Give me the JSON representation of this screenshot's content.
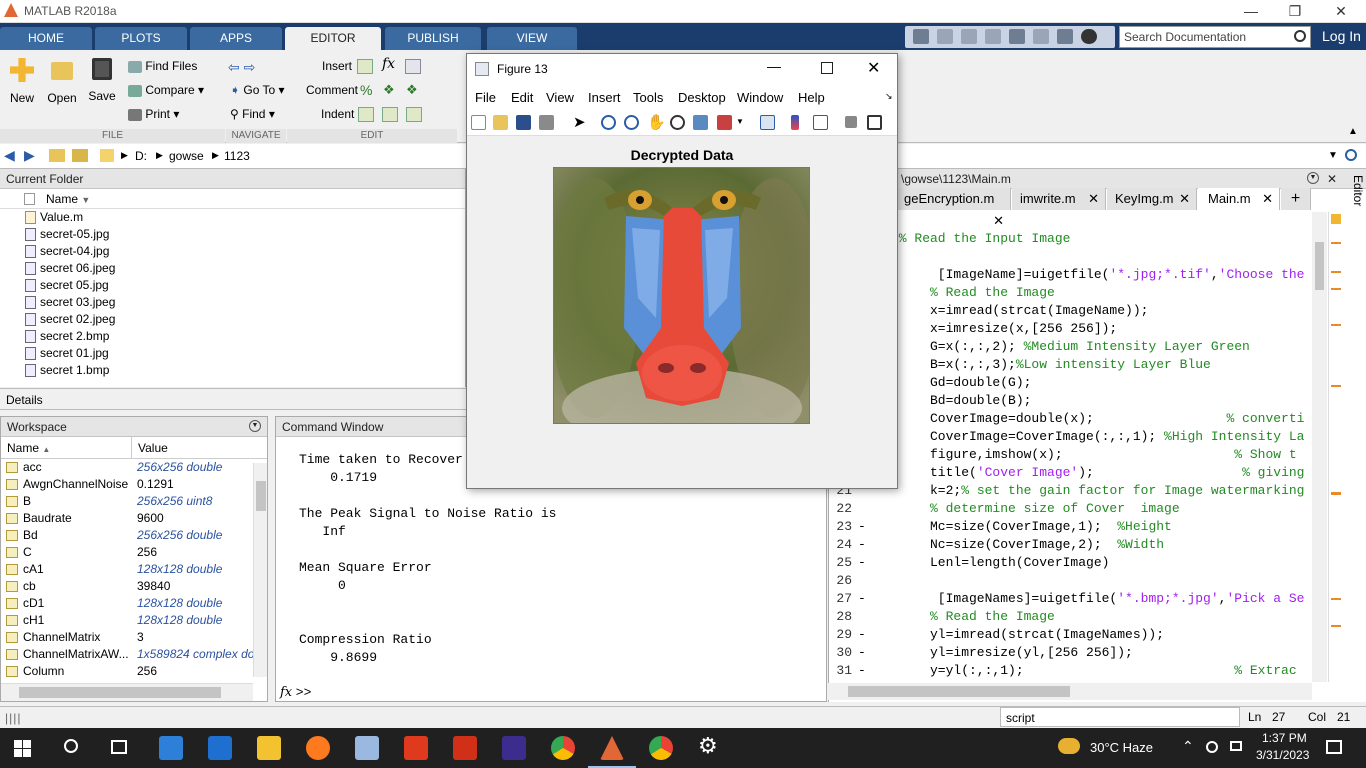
{
  "window": {
    "title": "MATLAB R2018a"
  },
  "ribbon_tabs": [
    "HOME",
    "PLOTS",
    "APPS",
    "EDITOR",
    "PUBLISH",
    "VIEW"
  ],
  "search": {
    "placeholder": "Search Documentation"
  },
  "login": "Log In",
  "ribbon": {
    "new": "New",
    "open": "Open",
    "save": "Save",
    "find_files": "Find Files",
    "compare": "Compare",
    "print": "Print",
    "go_to": "Go To",
    "find": "Find",
    "insert": "Insert",
    "comment": "Comment",
    "indent": "Indent",
    "groups": {
      "file": "FILE",
      "navigate": "NAVIGATE",
      "edit": "EDIT"
    }
  },
  "address": {
    "drive": "D:",
    "folder1": "gowse",
    "folder2": "1123"
  },
  "current_folder": {
    "title": "Current Folder",
    "column": "Name",
    "files": [
      "Value.m",
      "secret-05.jpg",
      "secret-04.jpg",
      "secret 06.jpeg",
      "secret 05.jpg",
      "secret 03.jpeg",
      "secret 02.jpeg",
      "secret 2.bmp",
      "secret 01.jpg",
      "secret 1.bmp"
    ]
  },
  "details": {
    "title": "Details"
  },
  "workspace": {
    "title": "Workspace",
    "col_name": "Name",
    "col_value": "Value",
    "rows": [
      {
        "name": "acc",
        "value": "256x256 double",
        "italic": true
      },
      {
        "name": "AwgnChannelNoise",
        "value": "0.1291",
        "italic": false
      },
      {
        "name": "B",
        "value": "256x256 uint8",
        "italic": true
      },
      {
        "name": "Baudrate",
        "value": "9600",
        "italic": false
      },
      {
        "name": "Bd",
        "value": "256x256 double",
        "italic": true
      },
      {
        "name": "C",
        "value": "256",
        "italic": false
      },
      {
        "name": "cA1",
        "value": "128x128 double",
        "italic": true
      },
      {
        "name": "cb",
        "value": "39840",
        "italic": false
      },
      {
        "name": "cD1",
        "value": "128x128 double",
        "italic": true
      },
      {
        "name": "cH1",
        "value": "128x128 double",
        "italic": true
      },
      {
        "name": "ChannelMatrix",
        "value": "3",
        "italic": false
      },
      {
        "name": "ChannelMatrixAW...",
        "value": "1x589824 complex do...",
        "italic": true
      },
      {
        "name": "Column",
        "value": "256",
        "italic": false
      }
    ]
  },
  "command_window": {
    "title": "Command Window",
    "lines": [
      "Time taken to Recover",
      "    0.1719",
      "",
      "The Peak Signal to Noise Ratio is",
      "   Inf",
      "",
      "Mean Square Error",
      "     0",
      "",
      "",
      "Compression Ratio",
      "    9.8699"
    ],
    "prompt": ">>"
  },
  "editor": {
    "path": "\\gowse\\1123\\Main.m",
    "side_label": "Editor",
    "tabs": [
      "geEncryption.m",
      "imwrite.m",
      "KeyImg.m",
      "Main.m"
    ],
    "lines": [
      {
        "n": "",
        "dash": "",
        "parts": [
          {
            "t": "% Read the Input Image",
            "c": "cmt"
          }
        ],
        "indent": -4
      },
      {
        "n": "",
        "dash": "",
        "parts": [],
        "indent": 0
      },
      {
        "n": "",
        "dash": "",
        "parts": [
          {
            "t": "[ImageName]=uigetfile(",
            "c": ""
          },
          {
            "t": "'*.jpg;*.tif'",
            "c": "str"
          },
          {
            "t": ",",
            "c": ""
          },
          {
            "t": "'Choose the",
            "c": "str"
          }
        ],
        "indent": 1
      },
      {
        "n": "",
        "dash": "",
        "parts": [
          {
            "t": "% Read the Image",
            "c": "cmt"
          }
        ],
        "indent": 0
      },
      {
        "n": "",
        "dash": "",
        "parts": [
          {
            "t": "x=imread(strcat(ImageName));",
            "c": ""
          }
        ],
        "indent": 0
      },
      {
        "n": "",
        "dash": "",
        "parts": [
          {
            "t": "x=imresize(x,[256 256]);",
            "c": ""
          }
        ],
        "indent": 0
      },
      {
        "n": "",
        "dash": "",
        "parts": [
          {
            "t": "G=x(:,:,2); ",
            "c": ""
          },
          {
            "t": "%Medium Intensity Layer Green",
            "c": "cmt"
          }
        ],
        "indent": 0
      },
      {
        "n": "",
        "dash": "",
        "parts": [
          {
            "t": "B=x(:,:,3);",
            "c": ""
          },
          {
            "t": "%Low intensity Layer Blue",
            "c": "cmt"
          }
        ],
        "indent": 0
      },
      {
        "n": "",
        "dash": "",
        "parts": [
          {
            "t": "Gd=double(G);",
            "c": ""
          }
        ],
        "indent": 0
      },
      {
        "n": "",
        "dash": "",
        "parts": [
          {
            "t": "Bd=double(B);",
            "c": ""
          }
        ],
        "indent": 0
      },
      {
        "n": "",
        "dash": "",
        "parts": [
          {
            "t": "CoverImage=double(x);                 ",
            "c": ""
          },
          {
            "t": "% converti",
            "c": "cmt"
          }
        ],
        "indent": 0
      },
      {
        "n": "",
        "dash": "",
        "parts": [
          {
            "t": "CoverImage=CoverImage(:,:,1); ",
            "c": ""
          },
          {
            "t": "%High Intensity La",
            "c": "cmt"
          }
        ],
        "indent": 0
      },
      {
        "n": "",
        "dash": "",
        "parts": [
          {
            "t": "figure,imshow(x);                      ",
            "c": ""
          },
          {
            "t": "% Show t",
            "c": "cmt"
          }
        ],
        "indent": 0
      },
      {
        "n": "",
        "dash": "",
        "parts": [
          {
            "t": "title(",
            "c": ""
          },
          {
            "t": "'Cover Image'",
            "c": "str"
          },
          {
            "t": ");                   ",
            "c": ""
          },
          {
            "t": "% giving",
            "c": "cmt"
          }
        ],
        "indent": 0
      },
      {
        "n": "21",
        "dash": "",
        "parts": [
          {
            "t": "k=2;",
            "c": ""
          },
          {
            "t": "% set the gain factor for Image watermarking",
            "c": "cmt"
          }
        ],
        "indent": 0
      },
      {
        "n": "22",
        "dash": "",
        "parts": [
          {
            "t": "% determine size of Cover  image",
            "c": "cmt"
          }
        ],
        "indent": 0
      },
      {
        "n": "23",
        "dash": "-",
        "parts": [
          {
            "t": "Mc=size(CoverImage,1);  ",
            "c": ""
          },
          {
            "t": "%Height",
            "c": "cmt"
          }
        ],
        "indent": 0
      },
      {
        "n": "24",
        "dash": "-",
        "parts": [
          {
            "t": "Nc=size(CoverImage,2);  ",
            "c": ""
          },
          {
            "t": "%Width",
            "c": "cmt"
          }
        ],
        "indent": 0
      },
      {
        "n": "25",
        "dash": "-",
        "parts": [
          {
            "t": "Lenl=length(CoverImage)",
            "c": ""
          }
        ],
        "indent": 0
      },
      {
        "n": "26",
        "dash": "",
        "parts": [],
        "indent": 0
      },
      {
        "n": "27",
        "dash": "-",
        "parts": [
          {
            "t": " [ImageNames]=uigetfile(",
            "c": ""
          },
          {
            "t": "'*.bmp;*.jpg'",
            "c": "str"
          },
          {
            "t": ",",
            "c": ""
          },
          {
            "t": "'Pick a Se",
            "c": "str"
          }
        ],
        "indent": 0
      },
      {
        "n": "28",
        "dash": "",
        "parts": [
          {
            "t": "% Read the Image",
            "c": "cmt"
          }
        ],
        "indent": 0
      },
      {
        "n": "29",
        "dash": "-",
        "parts": [
          {
            "t": "yl=imread(strcat(ImageNames));",
            "c": ""
          }
        ],
        "indent": 0
      },
      {
        "n": "30",
        "dash": "-",
        "parts": [
          {
            "t": "yl=imresize(yl,[256 256]);",
            "c": ""
          }
        ],
        "indent": 0
      },
      {
        "n": "31",
        "dash": "-",
        "parts": [
          {
            "t": "y=yl(:,:,1);                           ",
            "c": ""
          },
          {
            "t": "% Extrac",
            "c": "cmt"
          }
        ],
        "indent": 0
      }
    ]
  },
  "status": {
    "mode": "script",
    "ln_label": "Ln",
    "ln": "27",
    "col_label": "Col",
    "col": "21"
  },
  "figure": {
    "title": "Figure 13",
    "menu": [
      "File",
      "Edit",
      "View",
      "Insert",
      "Tools",
      "Desktop",
      "Window",
      "Help"
    ],
    "plot_title": "Decrypted Data"
  },
  "taskbar": {
    "weather": "30°C  Haze",
    "time": "1:37 PM",
    "date": "3/31/2023"
  }
}
